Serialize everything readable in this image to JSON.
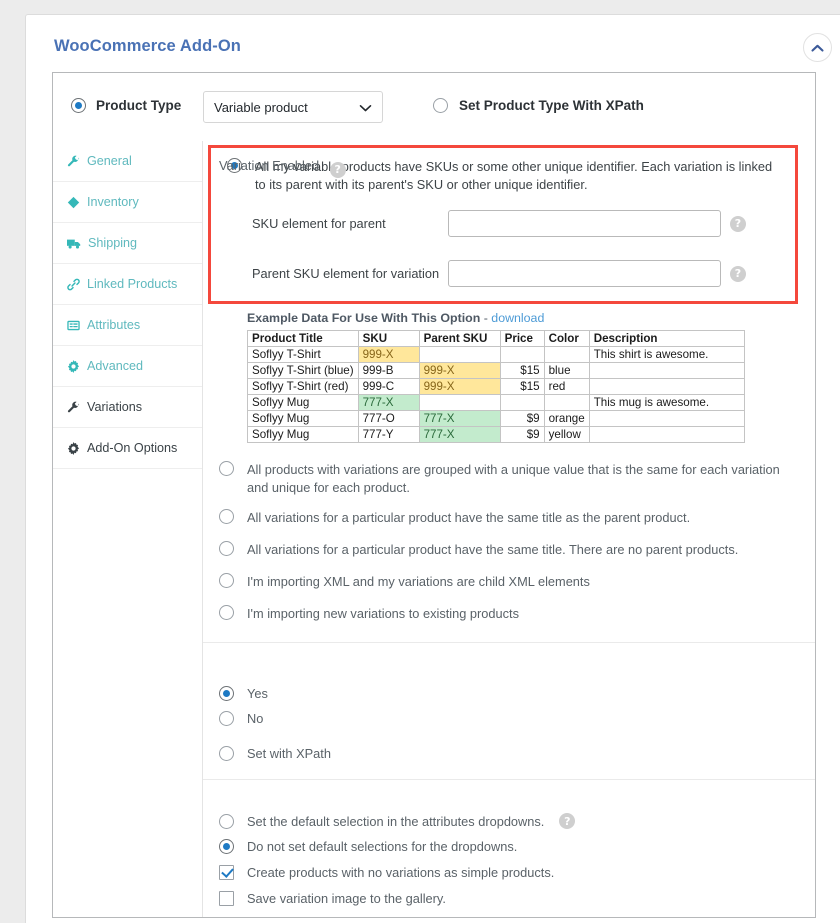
{
  "panel": {
    "title": "WooCommerce Add-On",
    "collapse_icon": "chevron-up-icon",
    "accent_blue": "#4a72b5",
    "highlight_border": "#f4483c"
  },
  "product_type": {
    "radio_label": "Product Type",
    "radio_checked": true,
    "select_value": "Variable product",
    "select_icon": "chevron-down-icon",
    "xpath_label": "Set Product Type With XPath",
    "xpath_checked": false
  },
  "sidebar": {
    "items": [
      {
        "label": "General",
        "icon": "wrench-icon",
        "active": false
      },
      {
        "label": "Inventory",
        "icon": "tag-icon",
        "active": false
      },
      {
        "label": "Shipping",
        "icon": "truck-icon",
        "active": false
      },
      {
        "label": "Linked Products",
        "icon": "link-icon",
        "active": false
      },
      {
        "label": "Attributes",
        "icon": "list-icon",
        "active": false
      },
      {
        "label": "Advanced",
        "icon": "gear-icon",
        "active": false
      },
      {
        "label": "Variations",
        "icon": "wrench-icon",
        "active": true
      },
      {
        "label": "Add-On Options",
        "icon": "gear-icon",
        "active": true
      }
    ]
  },
  "sku_block": {
    "option_text": "All my variable products have SKUs or some other unique identifier. Each variation is linked to its parent with its parent's SKU or other unique identifier.",
    "option_checked": true,
    "fields": [
      {
        "label": "SKU element for parent",
        "value": "",
        "placeholder": "",
        "help_icon": "help-icon"
      },
      {
        "label": "Parent SKU element for variation",
        "value": "",
        "placeholder": "",
        "help_icon": "help-icon"
      }
    ]
  },
  "example": {
    "caption": "Example Data For Use With This Option",
    "dash": " - ",
    "download_label": "download",
    "table": {
      "headers": [
        "Product Title",
        "SKU",
        "Parent SKU",
        "Price",
        "Color",
        "Description"
      ],
      "rows": [
        {
          "cells": [
            "Soflyy T-Shirt",
            "999-X",
            "",
            "",
            "",
            "This shirt is awesome."
          ],
          "hl": [
            "",
            "yellow",
            "",
            "",
            "",
            ""
          ]
        },
        {
          "cells": [
            "Soflyy T-Shirt (blue)",
            "999-B",
            "999-X",
            "$15",
            "blue",
            ""
          ],
          "hl": [
            "",
            "",
            "yellow",
            "",
            "",
            ""
          ]
        },
        {
          "cells": [
            "Soflyy T-Shirt (red)",
            "999-C",
            "999-X",
            "$15",
            "red",
            ""
          ],
          "hl": [
            "",
            "",
            "yellow",
            "",
            "",
            ""
          ]
        },
        {
          "cells": [
            "Soflyy Mug",
            "777-X",
            "",
            "",
            "",
            "This mug is awesome."
          ],
          "hl": [
            "",
            "green",
            "",
            "",
            "",
            ""
          ]
        },
        {
          "cells": [
            "Soflyy Mug",
            "777-O",
            "777-X",
            "$9",
            "orange",
            ""
          ],
          "hl": [
            "",
            "",
            "green",
            "",
            "",
            ""
          ]
        },
        {
          "cells": [
            "Soflyy Mug",
            "777-Y",
            "777-X",
            "$9",
            "yellow",
            ""
          ],
          "hl": [
            "",
            "",
            "green",
            "",
            "",
            ""
          ]
        }
      ]
    }
  },
  "options": [
    {
      "text": "All products with variations are grouped with a unique value that is the same for each variation and unique for each product.",
      "checked": false
    },
    {
      "text": "All variations for a particular product have the same title as the parent product.",
      "checked": false
    },
    {
      "text": "All variations for a particular product have the same title. There are no parent products.",
      "checked": false
    },
    {
      "text": "I'm importing XML and my variations are child XML elements",
      "checked": false
    },
    {
      "text": "I'm importing new variations to existing products",
      "checked": false
    }
  ],
  "variation_enabled": {
    "label": "Variation Enabled",
    "help_icon": "help-icon",
    "choices": [
      {
        "text": "Yes",
        "checked": true
      },
      {
        "text": "No",
        "checked": false
      },
      {
        "text": "Set with XPath",
        "checked": false
      }
    ]
  },
  "bottom_options": [
    {
      "type": "radio",
      "text": "Set the default selection in the attributes dropdowns.",
      "checked": false,
      "help_icon": "help-icon"
    },
    {
      "type": "radio",
      "text": "Do not set default selections for the dropdowns.",
      "checked": true,
      "help_icon": ""
    },
    {
      "type": "checkbox",
      "text": "Create products with no variations as simple products.",
      "checked": true,
      "help_icon": ""
    },
    {
      "type": "checkbox",
      "text": "Save variation image to the gallery.",
      "checked": false,
      "help_icon": ""
    }
  ]
}
